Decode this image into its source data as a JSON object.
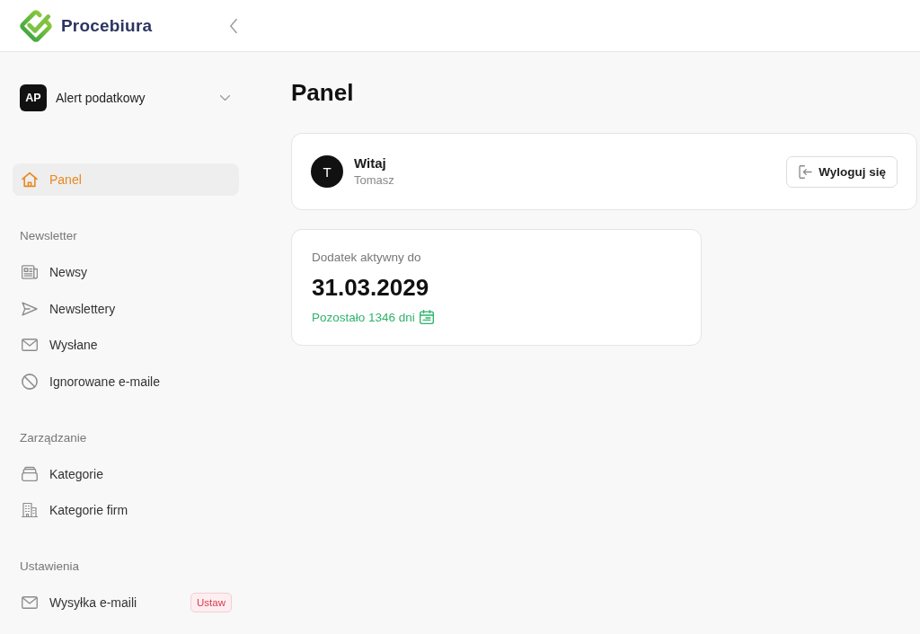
{
  "header": {
    "brand": "Procebiura"
  },
  "sidebar": {
    "workspace": {
      "initials": "AP",
      "name": "Alert podatkowy"
    },
    "groups": [
      {
        "items": [
          {
            "label": "Panel",
            "selected": true
          }
        ]
      },
      {
        "heading": "Newsletter",
        "items": [
          {
            "label": "Newsy",
            "selected": false
          },
          {
            "label": "Newslettery",
            "selected": false
          },
          {
            "label": "Wysłane",
            "selected": false
          },
          {
            "label": "Ignorowane e-maile",
            "selected": false
          }
        ]
      },
      {
        "heading": "Zarządzanie",
        "items": [
          {
            "label": "Kategorie",
            "selected": false
          },
          {
            "label": "Kategorie firm",
            "selected": false
          }
        ]
      },
      {
        "heading": "Ustawienia",
        "items": [
          {
            "label": "Wysyłka e-maili",
            "selected": false,
            "badge": "Ustaw"
          }
        ]
      }
    ]
  },
  "page_title": "Panel",
  "welcome_card": {
    "avatar_initial": "T",
    "greeting": "Witaj",
    "user_name": "Tomasz",
    "logout_button": "Wyloguj się"
  },
  "subscription_card": {
    "label": "Dodatek aktywny do",
    "date": "31.03.2029",
    "remaining": "Pozostało 1346 dni"
  }
}
